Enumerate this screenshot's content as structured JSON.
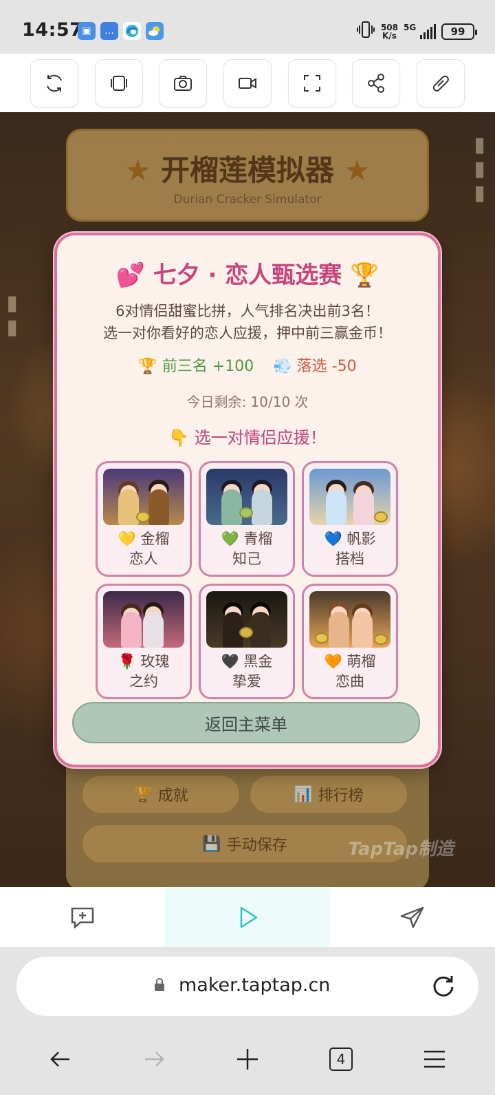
{
  "status_bar": {
    "time": "14:57",
    "net_speed_value": "508",
    "net_speed_unit": "K/s",
    "network": "5G",
    "battery": "99"
  },
  "toolbar": {
    "buttons": [
      "refresh-icon",
      "frames-icon",
      "camera-icon",
      "video-icon",
      "fullscreen-icon",
      "share-icon",
      "link-icon"
    ]
  },
  "game": {
    "title": "开榴莲模拟器",
    "subtitle": "Durian Cracker Simulator",
    "achievements_label": "成就",
    "leaderboard_label": "排行榜",
    "save_label": "手动保存",
    "watermark": "TapTap制造"
  },
  "modal": {
    "title_icon_left": "💕",
    "title": "七夕 · 恋人甄选赛",
    "title_icon_right": "🏆",
    "desc_line1": "6对情侣甜蜜比拼，人气排名决出前3名！",
    "desc_line2": "选一对你看好的恋人应援，押中前三赢金币！",
    "win_icon": "🏆",
    "win_text": "前三名 +100",
    "lose_icon": "💨",
    "lose_text": "落选 -50",
    "remaining": "今日剩余: 10/10 次",
    "prompt_icon": "👇",
    "prompt": "选一对情侣应援！",
    "couples": [
      {
        "icon": "💛",
        "line1": "金榴",
        "line2": "恋人"
      },
      {
        "icon": "💚",
        "line1": "青榴",
        "line2": "知己"
      },
      {
        "icon": "💙",
        "line1": "帆影",
        "line2": "搭档"
      },
      {
        "icon": "🌹",
        "line1": "玫瑰",
        "line2": "之约"
      },
      {
        "icon": "🖤",
        "line1": "黑金",
        "line2": "挚爱"
      },
      {
        "icon": "🧡",
        "line1": "萌榴",
        "line2": "恋曲"
      }
    ],
    "back_label": "返回主菜单"
  },
  "browser": {
    "url": "maker.taptap.cn",
    "tab_count": "4"
  },
  "colors": {
    "accent_pink": "#c6467c",
    "modal_border": "#d9709a",
    "win_green": "#4c9a43",
    "lose_orange": "#d2603c",
    "play_cyan": "#29c3c8"
  }
}
